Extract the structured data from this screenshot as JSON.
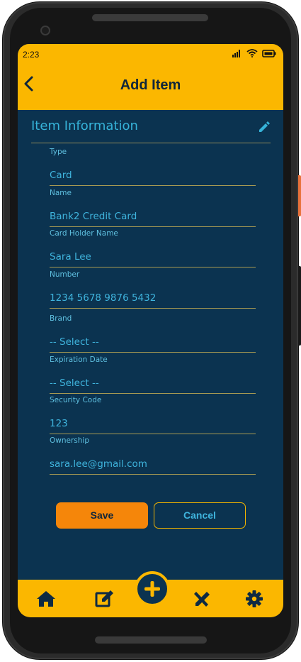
{
  "status_bar": {
    "time": "2:23"
  },
  "header": {
    "title": "Add Item"
  },
  "section": {
    "title": "Item Information"
  },
  "fields": [
    {
      "label": "Type",
      "value": "Card"
    },
    {
      "label": "Name",
      "value": "Bank2 Credit Card"
    },
    {
      "label": "Card Holder Name",
      "value": "Sara Lee"
    },
    {
      "label": "Number",
      "value": "1234 5678 9876 5432"
    },
    {
      "label": "Brand",
      "value": "-- Select --"
    },
    {
      "label": "Expiration Date",
      "value": "-- Select --"
    },
    {
      "label": "Security Code",
      "value": "123"
    },
    {
      "label": "Ownership",
      "value": "sara.lee@gmail.com"
    }
  ],
  "actions": {
    "save_label": "Save",
    "cancel_label": "Cancel"
  },
  "nav": {
    "items": [
      {
        "icon": "home-icon"
      },
      {
        "icon": "edit-icon"
      },
      {
        "icon": "add-icon"
      },
      {
        "icon": "tools-icon"
      },
      {
        "icon": "gear-icon"
      }
    ]
  },
  "colors": {
    "primary": "#fbb700",
    "background": "#0b3350",
    "accent": "#36b3d9",
    "save_button": "#f5860a"
  }
}
